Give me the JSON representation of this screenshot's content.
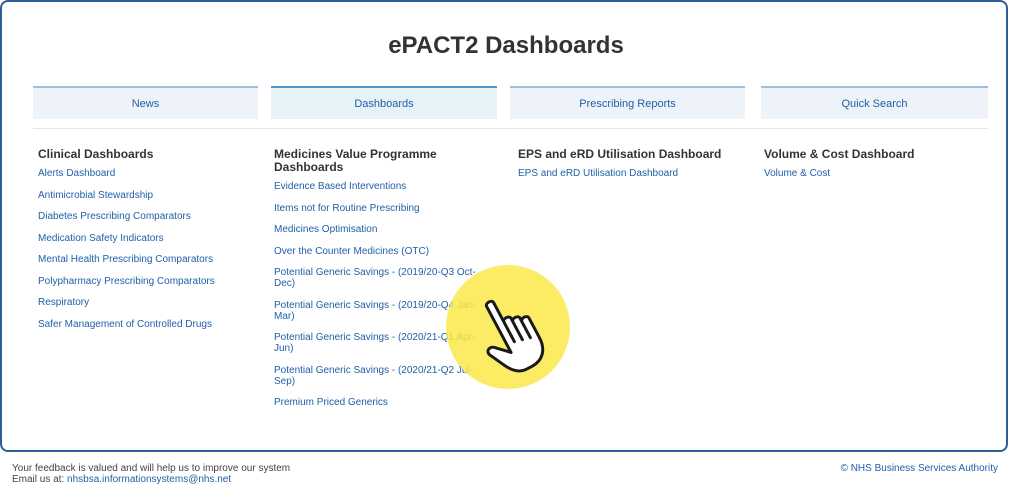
{
  "page": {
    "title": "ePACT2 Dashboards"
  },
  "tabs": [
    {
      "label": "News"
    },
    {
      "label": "Dashboards"
    },
    {
      "label": "Prescribing Reports"
    },
    {
      "label": "Quick Search"
    }
  ],
  "columns": [
    {
      "heading": "Clinical Dashboards",
      "items": [
        "Alerts Dashboard",
        "Antimicrobial Stewardship",
        "Diabetes Prescribing Comparators",
        "Medication Safety Indicators",
        "Mental Health Prescribing Comparators",
        "Polypharmacy Prescribing Comparators",
        "Respiratory",
        "Safer Management of Controlled Drugs"
      ]
    },
    {
      "heading": "Medicines Value Programme Dashboards",
      "items": [
        "Evidence Based Interventions",
        "Items not for Routine Prescribing",
        "Medicines Optimisation",
        "Over the Counter Medicines (OTC)",
        "Potential Generic Savings - (2019/20-Q3 Oct-Dec)",
        "Potential Generic Savings - (2019/20-Q4 Jan-Mar)",
        "Potential Generic Savings - (2020/21-Q1 Apr-Jun)",
        "Potential Generic Savings - (2020/21-Q2 Jul-Sep)",
        "Premium Priced Generics"
      ]
    },
    {
      "heading": "EPS and eRD Utilisation Dashboard",
      "items": [
        "EPS and eRD Utilisation Dashboard"
      ]
    },
    {
      "heading": "Volume & Cost Dashboard",
      "items": [
        "Volume & Cost"
      ]
    }
  ],
  "footer": {
    "feedback": "Your feedback is valued and will help us to improve our system",
    "email_prefix": "Email us at: ",
    "email": "nhsbsa.informationsystems@nhs.net",
    "copyright": "© NHS Business Services Authority"
  },
  "overlay": {
    "icon": "pointing-hand-cursor-icon",
    "highlight_color": "#fbe94a"
  }
}
